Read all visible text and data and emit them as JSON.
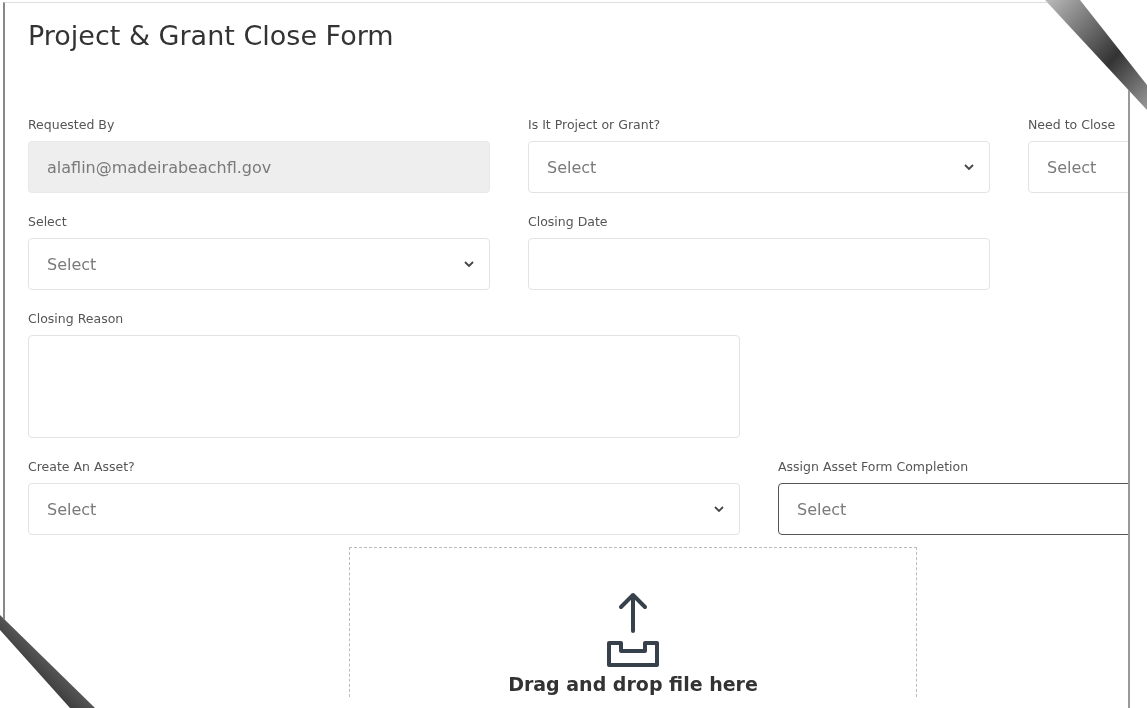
{
  "form": {
    "title": "Project & Grant Close Form",
    "fields": [
      {
        "label": "Requested By",
        "kind": "text",
        "value": "alaflin@madeirabeachfl.gov",
        "disabled": true,
        "focused": false
      },
      {
        "label": "Is It Project or Grant?",
        "kind": "select",
        "value": "Select",
        "disabled": false,
        "focused": false
      },
      {
        "label": "Need to Close",
        "kind": "select",
        "value": "Select",
        "disabled": false,
        "focused": false
      },
      {
        "label": "Select",
        "kind": "select",
        "value": "Select",
        "disabled": false,
        "focused": false
      },
      {
        "label": "Closing Date",
        "kind": "text",
        "disabled": false,
        "focused": false
      },
      {
        "label": "Closing Reason",
        "kind": "textarea",
        "disabled": false,
        "focused": false
      },
      {
        "label": "Create An Asset?",
        "kind": "select",
        "value": "Select",
        "disabled": false,
        "focused": false
      },
      {
        "label": "Assign Asset Form Completion",
        "kind": "select",
        "value": "Select",
        "disabled": false,
        "focused": true
      }
    ],
    "dropzone": {
      "text": "Drag and drop file here"
    }
  }
}
